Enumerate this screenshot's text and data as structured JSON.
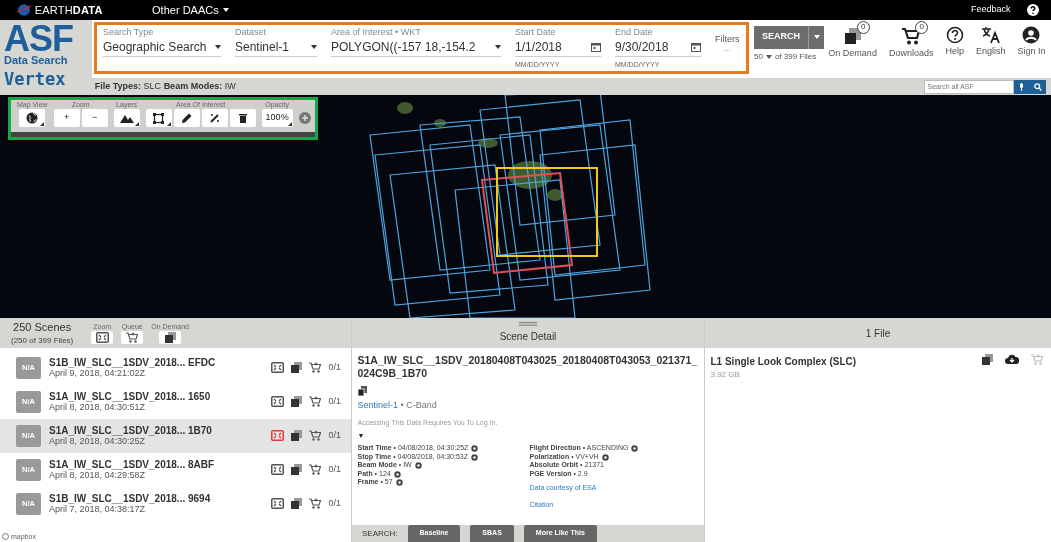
{
  "topbar": {
    "brand_light": "EARTH",
    "brand_bold": "DATA",
    "menu": "Other DAACs",
    "feedback": "Feedback"
  },
  "logo": {
    "title": "ASF",
    "subtitle": "Data Search",
    "product": "Vertex"
  },
  "search_form": {
    "fields": [
      {
        "kind": "select",
        "label": "Search Type",
        "value": "Geographic Search"
      },
      {
        "kind": "select",
        "label": "Dataset",
        "value": "Sentinel-1"
      },
      {
        "kind": "wide-select",
        "label": "Area of Interest • WKT",
        "value": "POLYGON((-157 18,-154.2"
      },
      {
        "kind": "date",
        "label": "Start Date",
        "value": "1/1/2018",
        "helper": "MM/DD/YYYY"
      },
      {
        "kind": "date",
        "label": "End Date",
        "value": "9/30/2018",
        "helper": "MM/DD/YYYY"
      }
    ],
    "filters": {
      "label": "Filters",
      "value": "..."
    }
  },
  "search_button": "SEARCH",
  "max_results": "50",
  "results_count": "of 399 Files",
  "header_icons": [
    {
      "kind": "on-demand",
      "label": "On Demand",
      "badge": "0"
    },
    {
      "kind": "cart",
      "label": "Downloads",
      "badge": "0"
    },
    {
      "kind": "help",
      "label": "Help"
    },
    {
      "kind": "translate",
      "label": "English"
    },
    {
      "kind": "account",
      "label": "Sign In"
    }
  ],
  "filters_summary": "**File Types:** SLC **Beam Modes:** IW",
  "site_search": {
    "placeholder": "Search all ASF"
  },
  "map_toolbar": {
    "groups": [
      {
        "label": "Map View",
        "buttons": [
          {
            "kind": "globe",
            "menu": true
          }
        ]
      },
      {
        "label": "Zoom",
        "buttons": [
          {
            "kind": "text",
            "label": "+",
            "menu": false
          },
          {
            "kind": "text",
            "label": "−",
            "menu": false
          }
        ]
      },
      {
        "label": "Layers",
        "buttons": [
          {
            "kind": "mountains",
            "menu": true
          }
        ]
      },
      {
        "label": "Area Of Interest",
        "buttons": [
          {
            "kind": "aoi-box",
            "menu": true
          },
          {
            "kind": "pencil",
            "menu": false
          },
          {
            "kind": "wand",
            "menu": false
          },
          {
            "kind": "trash",
            "menu": false
          }
        ]
      },
      {
        "label": "Opacity",
        "buttons": [
          {
            "kind": "text",
            "label": "100%",
            "menu": true
          }
        ]
      },
      {
        "buttons": [
          {
            "kind": "add"
          }
        ]
      }
    ]
  },
  "results": {
    "scene_count": "250 Scenes",
    "file_count": "(250 of 399 Files)",
    "tools": [
      {
        "label": "Zoom",
        "kind": "zoom"
      },
      {
        "label": "Queue",
        "kind": "queue"
      },
      {
        "label": "On Demand",
        "kind": "on-demand"
      }
    ],
    "scenes": [
      {
        "thumb": "N/A",
        "name": "S1B_IW_SLC__1SDV_2018... EFDC",
        "date": "April 9, 2018, 04:21:02Z",
        "files": "0/1",
        "selected": false
      },
      {
        "thumb": "N/A",
        "name": "S1A_IW_SLC__1SDV_2018... 1650",
        "date": "April 8, 2018, 04:30:51Z",
        "files": "0/1",
        "selected": false
      },
      {
        "thumb": "N/A",
        "name": "S1A_IW_SLC__1SDV_2018... 1B70",
        "date": "April 8, 2018, 04:30:25Z",
        "files": "0/1",
        "selected": true
      },
      {
        "thumb": "N/A",
        "name": "S1A_IW_SLC__1SDV_2018... 8ABF",
        "date": "April 8, 2018, 04:29:58Z",
        "files": "0/1",
        "selected": false
      },
      {
        "thumb": "N/A",
        "name": "S1B_IW_SLC__1SDV_2018... 9694",
        "date": "April 7, 2018, 04:38:17Z",
        "files": "0/1",
        "selected": false
      }
    ]
  },
  "detail": {
    "header": "Scene Detail",
    "title": "S1A_IW_SLC__1SDV_20180408T043025_20180408T043053_021371_024C9B_1B70",
    "dataset_link": "Sentinel-1",
    "band": "• C-Band",
    "notice": "Accessing This Data Requires You To Log In.",
    "toggle": "▼",
    "left": [
      {
        "label": "Start Time",
        "value": "• 04/08/2018, 04:30:25Z",
        "filter_icon": true
      },
      {
        "label": "Stop Time",
        "value": "• 04/08/2018, 04:30:53Z",
        "filter_icon": true
      },
      {
        "label": "Beam Mode",
        "value": "• IW",
        "filter_icon": true
      },
      {
        "label": "Path",
        "value": "• 124",
        "filter_icon": true
      },
      {
        "label": "Frame",
        "value": "• 57",
        "filter_icon": true
      }
    ],
    "right": [
      {
        "label": "Flight Direction",
        "value": "• ASCENDING",
        "filter_icon": true
      },
      {
        "label": "Polarization",
        "value": "• VV+VH",
        "filter_icon": true
      },
      {
        "label": "Absolute Orbit",
        "value": "• 21371",
        "filter_icon": false
      },
      {
        "label": "PGE Version",
        "value": "• 2.9",
        "filter_icon": false
      }
    ],
    "links": [
      "Data courtesy of ESA",
      "Citation"
    ],
    "search_label": "SEARCH:",
    "search_buttons": [
      "Baseline",
      "SBAS",
      "More Like This"
    ]
  },
  "files": {
    "header": "1 File",
    "items": [
      {
        "name": "L1 Single Look Complex (SLC)",
        "size": "3.92 GB"
      }
    ]
  },
  "attribution": "mapbox"
}
